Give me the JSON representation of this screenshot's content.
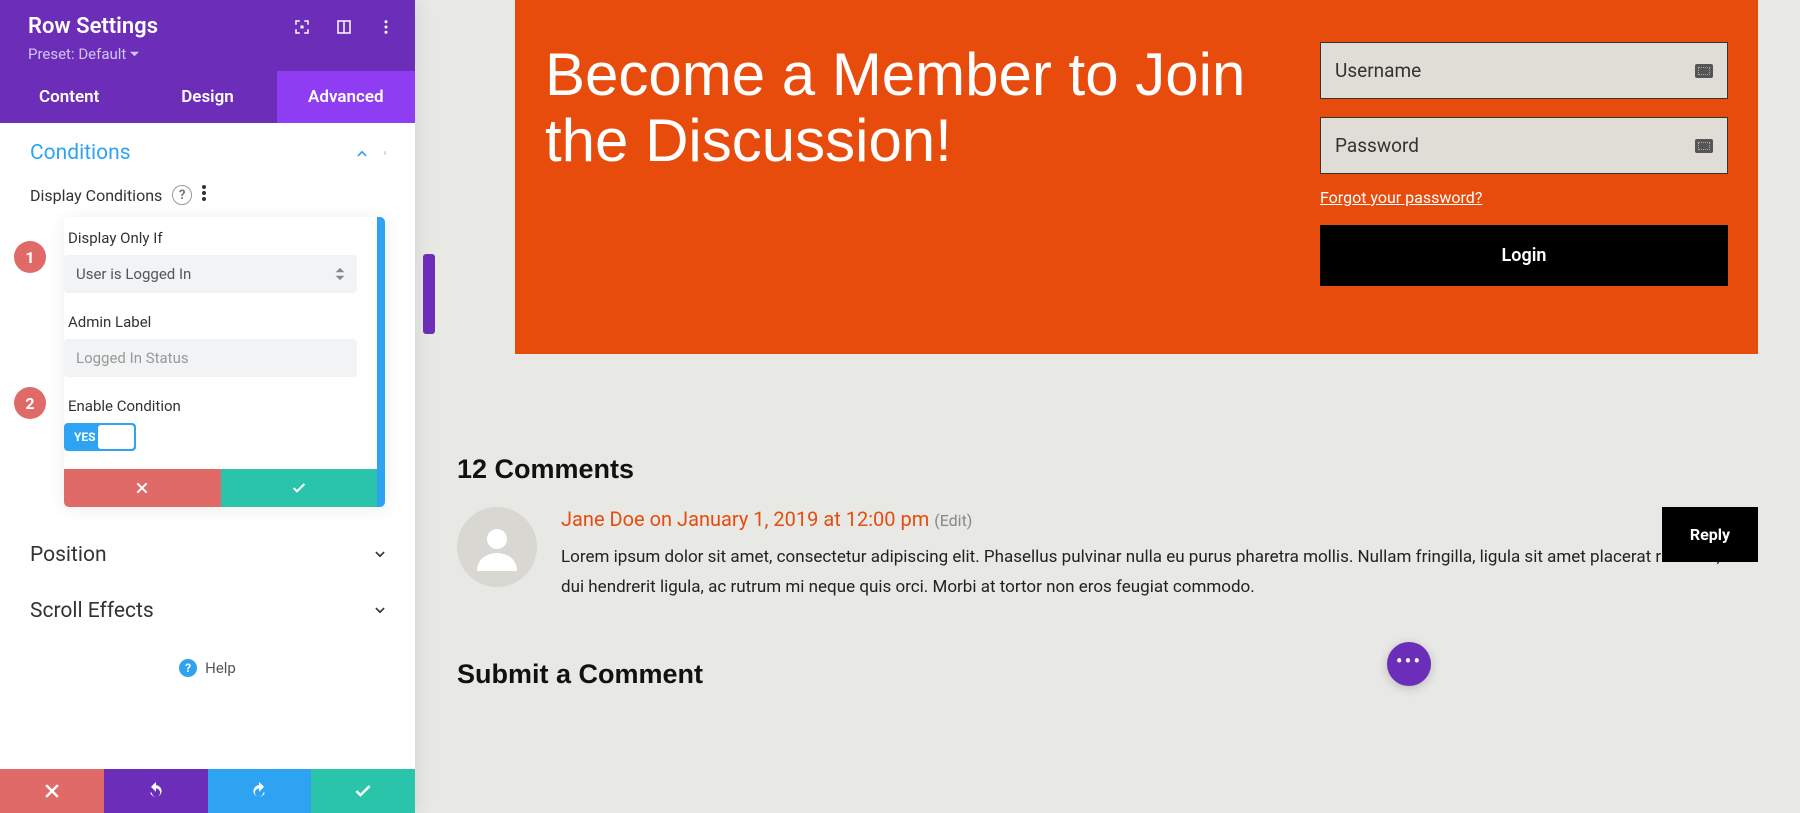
{
  "sidebar": {
    "title": "Row Settings",
    "preset": "Preset: Default",
    "tabs": {
      "content": "Content",
      "design": "Design",
      "advanced": "Advanced"
    },
    "section_conditions": "Conditions",
    "dc_label": "Display Conditions",
    "display_only_if": "Display Only If",
    "display_only_if_value": "User is Logged In",
    "admin_label": "Admin Label",
    "admin_label_value": "Logged In Status",
    "enable_condition": "Enable Condition",
    "toggle_yes": "YES",
    "section_position": "Position",
    "section_scroll": "Scroll Effects",
    "help": "Help",
    "badge1": "1",
    "badge2": "2"
  },
  "hero": {
    "title": "Become a Member to Join the Discussion!",
    "username": "Username",
    "password": "Password",
    "forgot": "Forgot your password?",
    "login": "Login"
  },
  "comments": {
    "title": "12 Comments",
    "author": "Jane Doe",
    "on": " on ",
    "date": "January 1, 2019 at 12:00 pm",
    "edit": "(Edit)",
    "text": "Lorem ipsum dolor sit amet, consectetur adipiscing elit. Phasellus pulvinar nulla eu purus pharetra mollis. Nullam fringilla, ligula sit amet placerat rhoncus, arcu dui hendrerit ligula, ac rutrum mi neque quis orci. Morbi at tortor non eros feugiat commodo.",
    "reply": "Reply",
    "submit": "Submit a Comment"
  }
}
